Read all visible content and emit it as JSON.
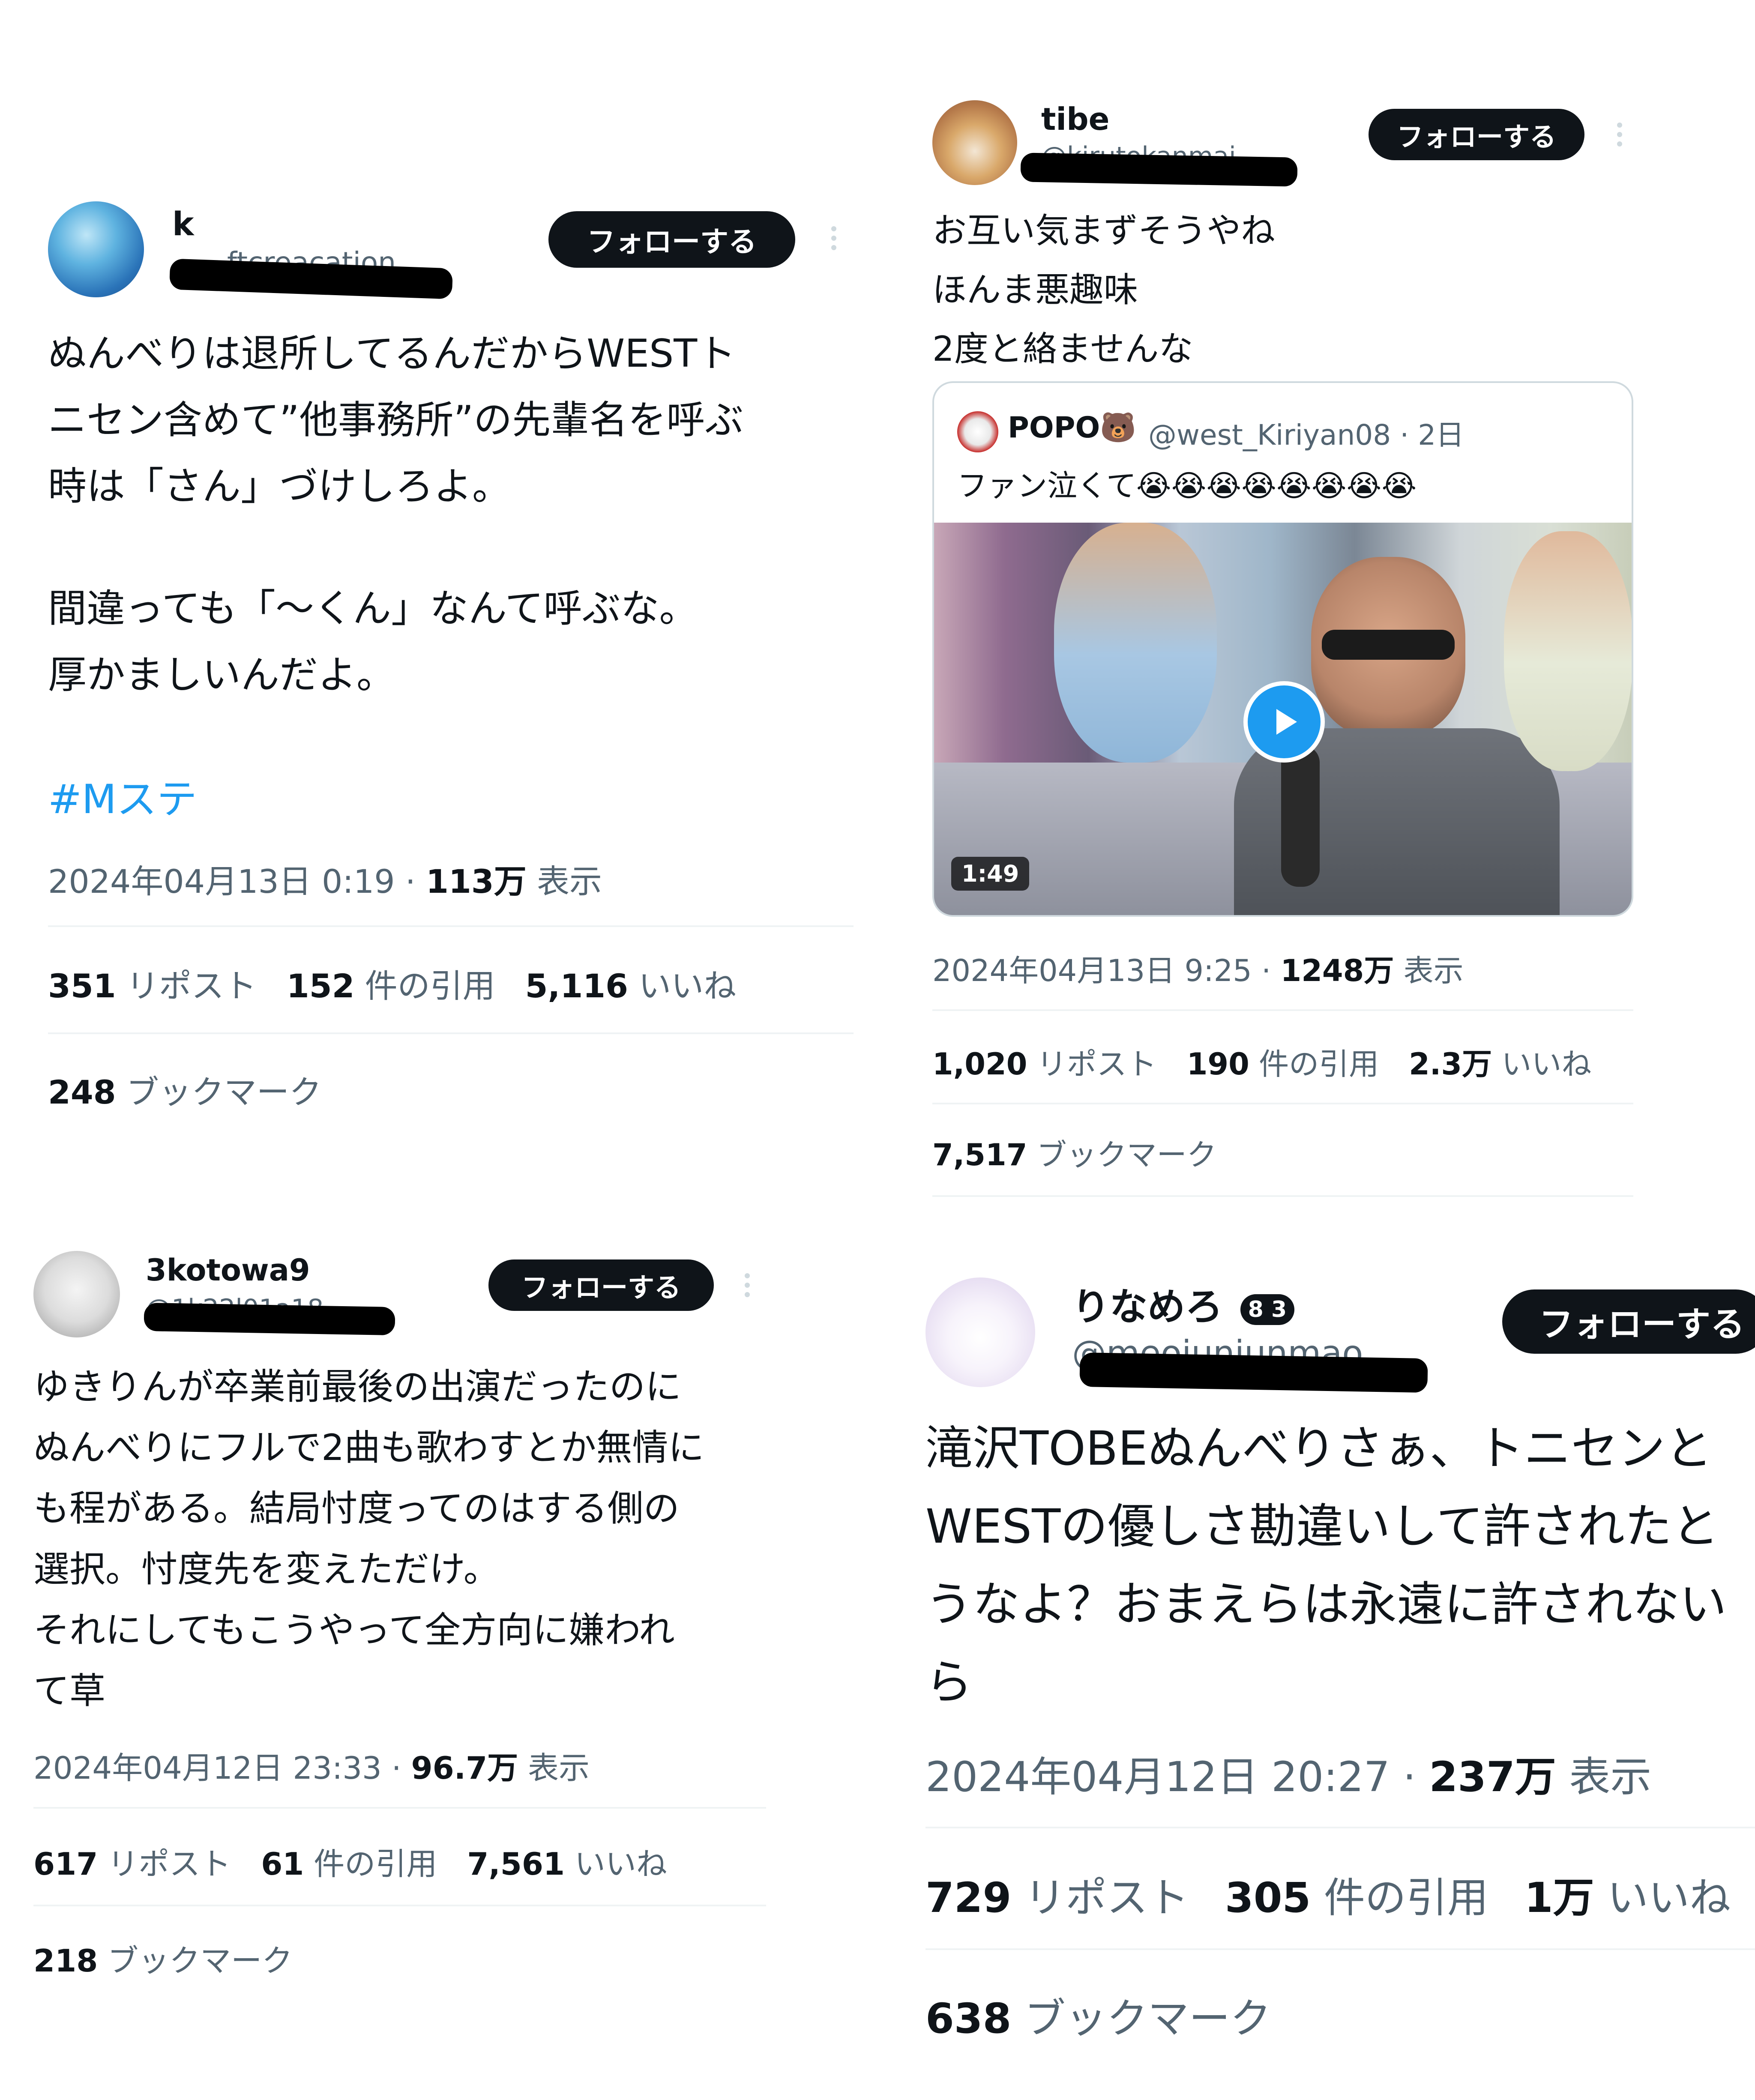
{
  "follow_label": "フォローする",
  "tweets": [
    {
      "name": "k",
      "handle": "ftcreacation",
      "body_lines": [
        "ぬんべりは退所してるんだからWESTト",
        "ニセン含めて”他事務所”の先輩名を呼ぶ",
        "時は「さん」づけしろよ。",
        "",
        "間違っても「〜くん」なんて呼ぶな。",
        "厚かましいんだよ。"
      ],
      "hashtag": "#Mステ",
      "timestamp": "2024年04月13日 0:19 · ",
      "views": "113万",
      "views_label": " 表示",
      "reposts": "351",
      "reposts_label": " リポスト",
      "quotes": "152",
      "quotes_label": " 件の引用",
      "likes": "5,116",
      "likes_label": " いいね",
      "bookmarks": "248",
      "bookmarks_label": " ブックマーク"
    },
    {
      "name": "tibe",
      "handle": "@kirutokanmai",
      "body_lines": [
        "お互い気まずそうやね",
        "ほんま悪趣味",
        "2度と絡ませんな"
      ],
      "quote": {
        "name": "POPO🐻",
        "handle": "@west_Kiriyan08 · 2日",
        "text": "ファン泣くて😭😭😭😭😭😭😭😭",
        "video_duration": "1:49"
      },
      "timestamp": "2024年04月13日 9:25 · ",
      "views": "1248万",
      "views_label": " 表示",
      "reposts": "1,020",
      "reposts_label": " リポスト",
      "quotes": "190",
      "quotes_label": " 件の引用",
      "likes": "2.3万",
      "likes_label": " いいね",
      "bookmarks": "7,517",
      "bookmarks_label": " ブックマーク"
    },
    {
      "name": "3kotowa9",
      "handle": "@1k22l01a18",
      "body_lines": [
        "ゆきりんが卒業前最後の出演だったのに",
        "ぬんべりにフルで2曲も歌わすとか無情に",
        "も程がある。結局忖度ってのはする側の",
        "選択。忖度先を変えただけ。",
        "それにしてもこうやって全方向に嫌われ",
        "て草"
      ],
      "timestamp": "2024年04月12日 23:33 · ",
      "views": "96.7万",
      "views_label": " 表示",
      "reposts": "617",
      "reposts_label": " リポスト",
      "quotes": "61",
      "quotes_label": " 件の引用",
      "likes": "7,561",
      "likes_label": " いいね",
      "bookmarks": "218",
      "bookmarks_label": " ブックマーク"
    },
    {
      "name": "りなめろ",
      "name_badges": "8 3",
      "handle": "@meojunjunmao",
      "body_lines": [
        "滝沢TOBEぬんべりさぁ、トニセンと",
        "WESTの優しさ勘違いして許されたと",
        "うなよ？おまえらは永遠に許されない",
        "ら"
      ],
      "timestamp": "2024年04月12日 20:27 · ",
      "views": "237万",
      "views_label": " 表示",
      "reposts": "729",
      "reposts_label": " リポスト",
      "quotes": "305",
      "quotes_label": " 件の引用",
      "likes": "1万",
      "likes_label": " いいね",
      "bookmarks": "638",
      "bookmarks_label": " ブックマーク"
    }
  ]
}
